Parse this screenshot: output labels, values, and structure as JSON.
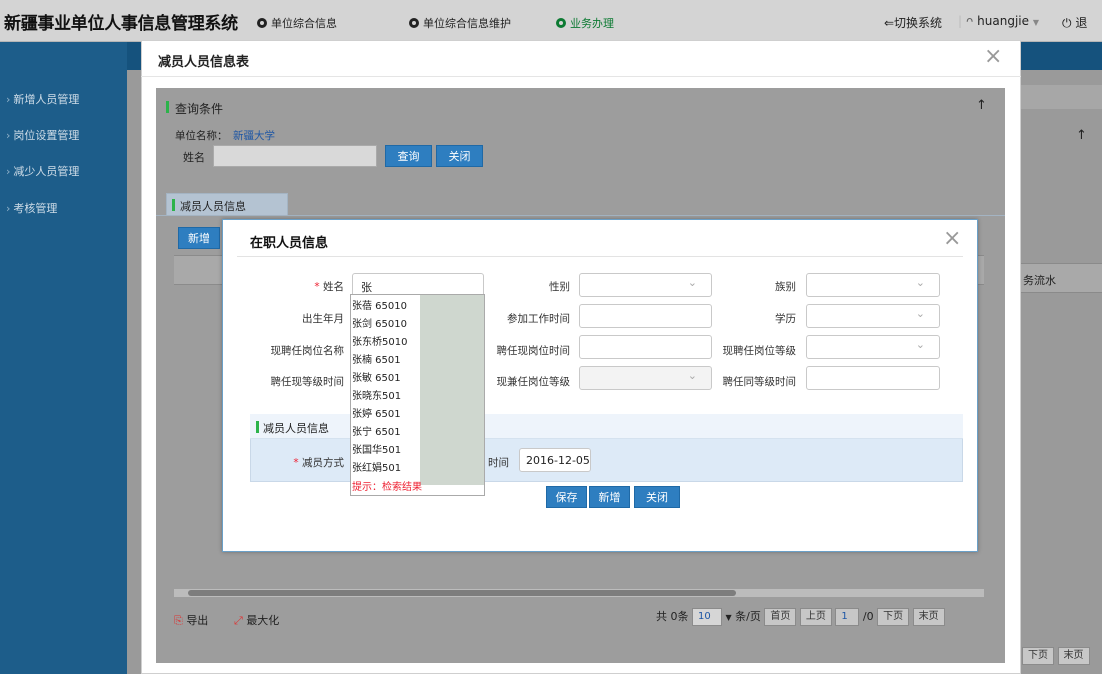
{
  "app": {
    "title": "新疆事业单位人事信息管理系统"
  },
  "topnav": [
    {
      "label": "单位综合信息"
    },
    {
      "label": "单位综合信息维护"
    },
    {
      "label": "业务办理"
    }
  ],
  "top_right": {
    "switch": "⇐切换系统",
    "user": "huangjie",
    "logout": "退"
  },
  "sidebar": {
    "items": [
      {
        "label": "新增人员管理"
      },
      {
        "label": "岗位设置管理"
      },
      {
        "label": "减少人员管理"
      },
      {
        "label": "考核管理"
      }
    ]
  },
  "bg": {
    "flow_header": "务流水",
    "next_page": "下页",
    "last_page": "末页"
  },
  "modal1": {
    "title": "减员人员信息表",
    "query": {
      "section_title": "查询条件",
      "unit_label": "单位名称：",
      "unit_value": "新疆大学",
      "name_label": "姓名",
      "query_button": "查询",
      "close_button": "关闭"
    },
    "tab": "减员人员信息",
    "add_button": "新增",
    "export": "导出",
    "maximize": "最大化",
    "pager": {
      "total": "共 0条",
      "page_size": "10",
      "per_page": "条/页",
      "first": "首页",
      "prev": "上页",
      "current": "1",
      "of": "/0",
      "next": "下页",
      "last": "末页"
    }
  },
  "modal2": {
    "title": "在职人员信息",
    "labels": {
      "name": "姓名",
      "gender": "性别",
      "ethnicity": "族别",
      "birth": "出生年月",
      "work_start": "参加工作时间",
      "education": "学历",
      "current_post": "现聘任岗位名称",
      "current_post_time": "聘任现岗位时间",
      "current_post_level": "现聘任岗位等级",
      "current_level_time": "聘任现等级时间",
      "concurrent_level": "现兼任岗位等级",
      "same_level_time": "聘任同等级时间"
    },
    "name_value": "张",
    "subsection": "减员人员信息",
    "reduce_method_label": "减员方式",
    "time_label": "时间",
    "time_value": "2016-12-05",
    "buttons": {
      "save": "保存",
      "add": "新增",
      "close": "关闭"
    },
    "dropdown": {
      "items": [
        "张蓓 65010",
        "张剑 65010",
        "张东桥5010",
        "张楠 6501",
        "张敏 6501",
        "张晓东501",
        "张婷 6501",
        "张宁 6501",
        "张国华501",
        "张红娟501"
      ],
      "hint": "提示：检索结果"
    }
  }
}
